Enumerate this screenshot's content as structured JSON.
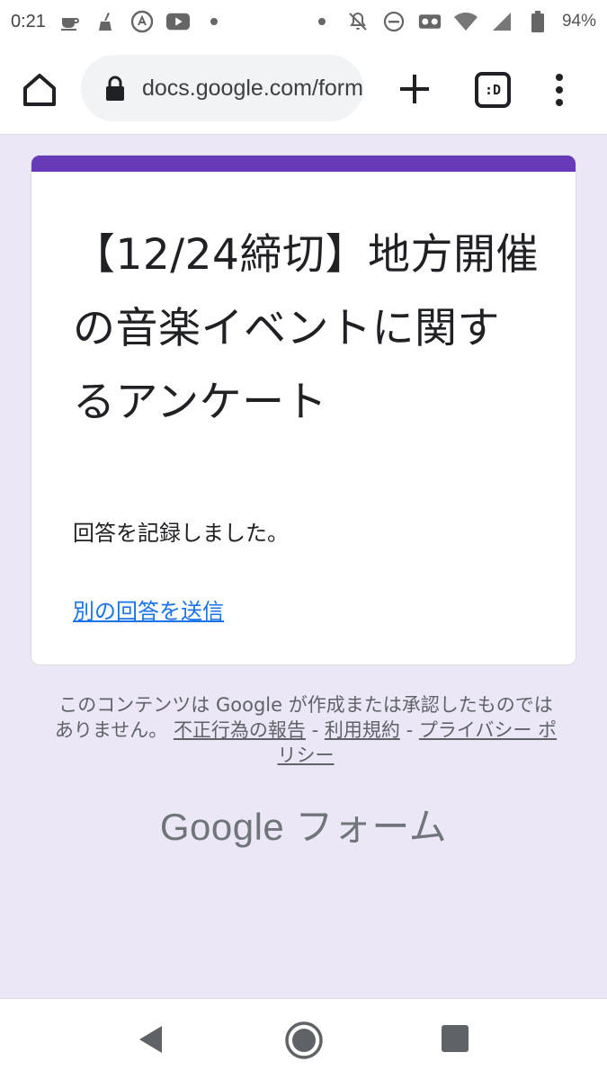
{
  "status_bar": {
    "time": "0:21",
    "battery": "94%"
  },
  "browser": {
    "url": "docs.google.com/forms",
    "tab_switcher_label": ":D"
  },
  "form": {
    "title": "【12/24締切】地方開催の音楽イベントに関するアンケート",
    "confirmation": "回答を記録しました。",
    "submit_another": "別の回答を送信"
  },
  "footer": {
    "disclaimer": "このコンテンツは Google が作成または承認したものではありません。",
    "link_report": "不正行為の報告",
    "link_terms": "利用規約",
    "link_privacy": "プライバシー ポリシー",
    "separator": "-",
    "brand": "Google フォーム"
  },
  "colors": {
    "accent": "#673ab7",
    "background": "#ece7f6",
    "link": "#1a73e8"
  }
}
